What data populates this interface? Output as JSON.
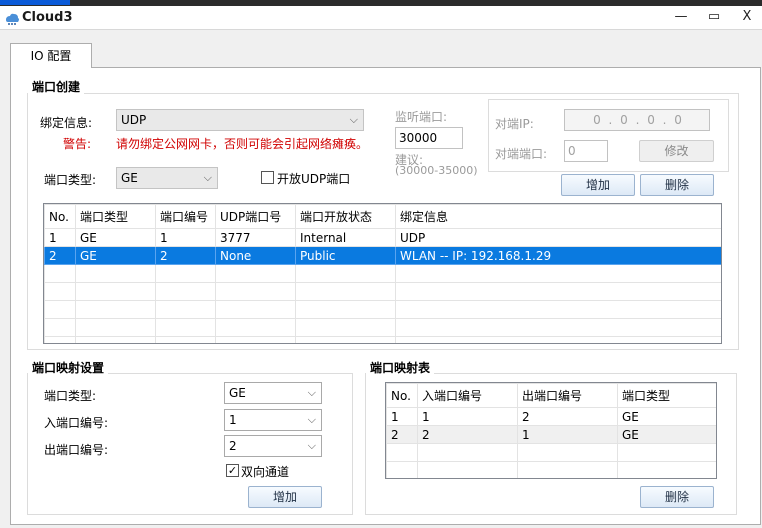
{
  "window": {
    "title": "Cloud3",
    "minimize": "—",
    "maximize": "▭",
    "close": "X"
  },
  "tabs": [
    {
      "label": "IO 配置"
    }
  ],
  "port_creation": {
    "title": "端口创建",
    "bind_info_label": "绑定信息:",
    "bind_info_value": "UDP",
    "warning_label": "警告:",
    "warning_text": "请勿绑定公网网卡，否则可能会引起网络瘫痪。",
    "port_type_label": "端口类型:",
    "port_type_value": "GE",
    "open_udp_label": "开放UDP端口",
    "listen_port_label": "监听端口:",
    "listen_port_value": "30000",
    "suggest_label": "建议:",
    "suggest_range": "(30000-35000)",
    "peer_ip_label": "对端IP:",
    "peer_ip_value": "0 . 0 . 0 . 0",
    "peer_port_label": "对端端口:",
    "peer_port_value": "0",
    "modify_button": "修改",
    "add_button": "增加",
    "delete_button": "删除",
    "table": {
      "columns": [
        "No.",
        "端口类型",
        "端口编号",
        "UDP端口号",
        "端口开放状态",
        "绑定信息"
      ],
      "rows": [
        [
          "1",
          "GE",
          "1",
          "3777",
          "Internal",
          "UDP"
        ],
        [
          "2",
          "GE",
          "2",
          "None",
          "Public",
          "WLAN -- IP: 192.168.1.29"
        ]
      ]
    }
  },
  "port_mapping_settings": {
    "title": "端口映射设置",
    "port_type_label": "端口类型:",
    "port_type_value": "GE",
    "in_port_label": "入端口编号:",
    "in_port_value": "1",
    "out_port_label": "出端口编号:",
    "out_port_value": "2",
    "bidirectional_label": "双向通道",
    "add_button": "增加"
  },
  "port_mapping_table": {
    "title": "端口映射表",
    "columns": [
      "No.",
      "入端口编号",
      "出端口编号",
      "端口类型"
    ],
    "rows": [
      [
        "1",
        "1",
        "2",
        "GE"
      ],
      [
        "2",
        "2",
        "1",
        "GE"
      ]
    ],
    "delete_button": "删除"
  }
}
